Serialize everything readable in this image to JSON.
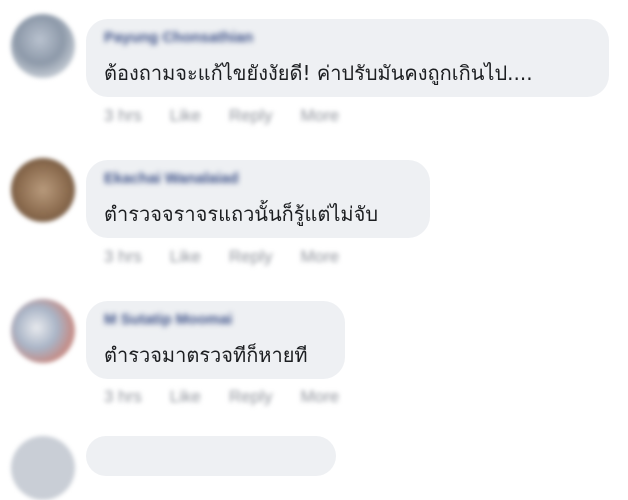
{
  "comments": [
    {
      "author": "Payung Chonsathian",
      "text": "ต้องถามจะแก้ไขยังงัยดี! ค่าปรับมันคงถูกเกินไป....",
      "actions": {
        "time": "3 hrs",
        "like": "Like",
        "reply": "Reply",
        "more": "More"
      }
    },
    {
      "author": "Ekachai Wanalaiad",
      "text": "ตำรวจจราจรแถวนั้นก็รู้แต่ไม่จับ",
      "actions": {
        "time": "3 hrs",
        "like": "Like",
        "reply": "Reply",
        "more": "More"
      }
    },
    {
      "author": "M Sutatip Moomai",
      "text": "ตำรวจมาตรวจทีก็หายที",
      "actions": {
        "time": "3 hrs",
        "like": "Like",
        "reply": "Reply",
        "more": "More"
      }
    }
  ]
}
